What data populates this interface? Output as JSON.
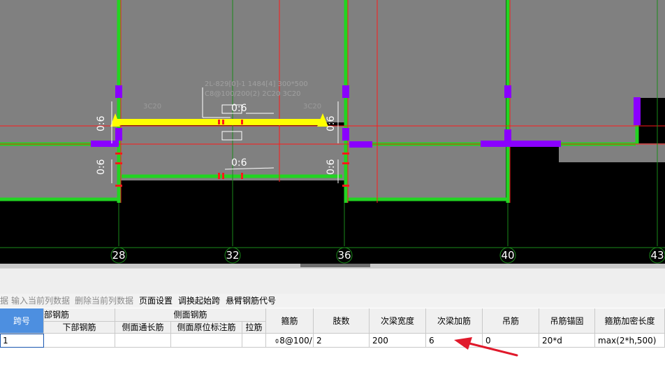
{
  "canvas": {
    "axis_labels": [
      "28",
      "32",
      "36",
      "40",
      "43"
    ],
    "beam_label_1": "0:6",
    "beam_label_2": "0:6",
    "beam_label_3": "0:6",
    "beam_label_4": "0:6",
    "beam_label_5": "0:6",
    "beam_label_6": "0:6",
    "faint_text_1": "3C20",
    "faint_text_2": "3C20",
    "faint_text_3": "2L-829[0]-1 1484[4] 300*500",
    "faint_text_4": "C8@100/200(2) 2C20 3C20",
    "colors": {
      "concrete": "#808080",
      "wall_green": "#22d422",
      "selected_beam": "#ffff00",
      "column_purple": "#8a00ff",
      "red_line": "#ff1a1a",
      "axis_green": "#1a8a1a"
    }
  },
  "toolbar": {
    "item_0": "据",
    "item_1": "输入当前列数据",
    "item_2": "删除当前列数据",
    "item_3": "页面设置",
    "item_4": "调换起始跨",
    "item_5": "悬臂钢筋代号"
  },
  "table": {
    "h_span": "跨号",
    "h_bottom_group": "部钢筋",
    "h_bottom": "下部钢筋",
    "h_side_group": "侧面钢筋",
    "h_side_long": "侧面通长筋",
    "h_side_orig": "侧面原位标注筋",
    "h_tie": "拉筋",
    "h_stirrup": "箍筋",
    "h_legs": "肢数",
    "h_sub_width": "次梁宽度",
    "h_sub_add": "次梁加筋",
    "h_hanger": "吊筋",
    "h_hanger_anchor": "吊筋锚固",
    "h_dense_len": "箍筋加密长度",
    "row": {
      "span": "1",
      "bottom": "",
      "side_long": "",
      "side_orig": "",
      "tie": "",
      "stirrup": "⌽8@100/",
      "legs": "2",
      "sub_width": "200",
      "sub_add": "6",
      "hanger": "0",
      "hanger_anchor": "20*d",
      "dense_len": "max(2*h,500)"
    }
  },
  "annotation_color": "#e0192b"
}
